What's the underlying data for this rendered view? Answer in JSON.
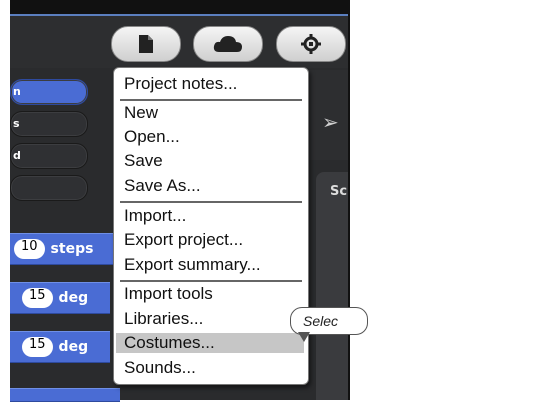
{
  "toolbar": {
    "file_icon": "file-icon",
    "cloud_icon": "cloud-icon",
    "settings_icon": "gear-icon"
  },
  "palette": {
    "categories": [
      {
        "label": "n",
        "active": true
      },
      {
        "label": "s",
        "active": false
      },
      {
        "label": "d",
        "active": false
      },
      {
        "label": "",
        "active": false
      }
    ],
    "blocks": [
      {
        "value": "10",
        "label": "steps"
      },
      {
        "value": "15",
        "label": "deg"
      },
      {
        "value": "15",
        "label": "deg"
      }
    ]
  },
  "stage": {
    "label": "Sc"
  },
  "file_menu": {
    "items": [
      {
        "label": "Project notes..."
      },
      {
        "label": "New"
      },
      {
        "label": "Open..."
      },
      {
        "label": "Save"
      },
      {
        "label": "Save As..."
      },
      {
        "label": "Import..."
      },
      {
        "label": "Export project..."
      },
      {
        "label": "Export summary..."
      },
      {
        "label": "Import tools"
      },
      {
        "label": "Libraries..."
      },
      {
        "label": "Costumes...",
        "highlighted": true
      },
      {
        "label": "Sounds..."
      }
    ]
  },
  "tooltip": {
    "text": "Selec"
  },
  "colors": {
    "block_blue": "#4a6cd4",
    "background_dark": "#2a2b2d",
    "menu_highlight": "#c6c6c6"
  }
}
